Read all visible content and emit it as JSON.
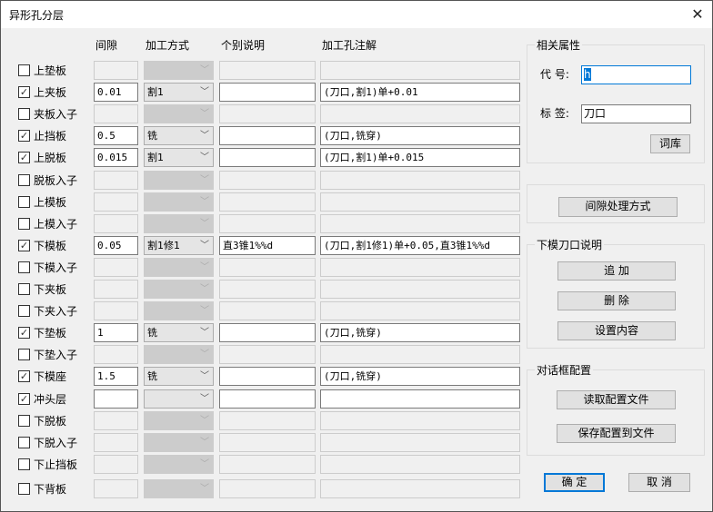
{
  "window": {
    "title": "异形孔分层",
    "close_icon": "close-icon"
  },
  "headers": {
    "gap": "间隙",
    "method": "加工方式",
    "note": "个别说明",
    "annotation": "加工孔注解"
  },
  "rows": [
    {
      "label": "上垫板",
      "checked": false,
      "gap": "",
      "method": "",
      "note": "",
      "annotation": "",
      "enabled": false
    },
    {
      "label": "上夹板",
      "checked": true,
      "gap": "0.01",
      "method": "割1",
      "note": "",
      "annotation": "(刀口,割1)单+0.01",
      "enabled": true
    },
    {
      "label": "夹板入子",
      "checked": false,
      "gap": "",
      "method": "",
      "note": "",
      "annotation": "",
      "enabled": false
    },
    {
      "label": "止挡板",
      "checked": true,
      "gap": "0.5",
      "method": "铣",
      "note": "",
      "annotation": "(刀口,铣穿)",
      "enabled": true
    },
    {
      "label": "上脱板",
      "checked": true,
      "gap": "0.015",
      "method": "割1",
      "note": "",
      "annotation": "(刀口,割1)单+0.015",
      "enabled": true
    },
    {
      "label": "脱板入子",
      "checked": false,
      "gap": "",
      "method": "",
      "note": "",
      "annotation": "",
      "enabled": false
    },
    {
      "label": "上模板",
      "checked": false,
      "gap": "",
      "method": "",
      "note": "",
      "annotation": "",
      "enabled": false
    },
    {
      "label": "上模入子",
      "checked": false,
      "gap": "",
      "method": "",
      "note": "",
      "annotation": "",
      "enabled": false
    },
    {
      "label": "下模板",
      "checked": true,
      "gap": "0.05",
      "method": "割1修1",
      "note": "直3锥1%%d",
      "annotation": "(刀口,割1修1)单+0.05,直3锥1%%d",
      "enabled": true
    },
    {
      "label": "下模入子",
      "checked": false,
      "gap": "",
      "method": "",
      "note": "",
      "annotation": "",
      "enabled": false
    },
    {
      "label": "下夹板",
      "checked": false,
      "gap": "",
      "method": "",
      "note": "",
      "annotation": "",
      "enabled": false
    },
    {
      "label": "下夹入子",
      "checked": false,
      "gap": "",
      "method": "",
      "note": "",
      "annotation": "",
      "enabled": false
    },
    {
      "label": "下垫板",
      "checked": true,
      "gap": "1",
      "method": "铣",
      "note": "",
      "annotation": "(刀口,铣穿)",
      "enabled": true
    },
    {
      "label": "下垫入子",
      "checked": false,
      "gap": "",
      "method": "",
      "note": "",
      "annotation": "",
      "enabled": false
    },
    {
      "label": "下模座",
      "checked": true,
      "gap": "1.5",
      "method": "铣",
      "note": "",
      "annotation": "(刀口,铣穿)",
      "enabled": true
    },
    {
      "label": "冲头层",
      "checked": true,
      "gap": "",
      "method": "",
      "note": "",
      "annotation": "",
      "enabled": true
    },
    {
      "label": "下脱板",
      "checked": false,
      "gap": "",
      "method": "",
      "note": "",
      "annotation": "",
      "enabled": false
    },
    {
      "label": "下脱入子",
      "checked": false,
      "gap": "",
      "method": "",
      "note": "",
      "annotation": "",
      "enabled": false
    },
    {
      "label": "下止挡板",
      "checked": false,
      "gap": "",
      "method": "",
      "note": "",
      "annotation": "",
      "enabled": false
    },
    {
      "label": "下背板",
      "checked": false,
      "gap": "",
      "method": "",
      "note": "",
      "annotation": "",
      "enabled": false
    }
  ],
  "props": {
    "title": "相关属性",
    "code_label": "代 号:",
    "code_value": "h",
    "tag_label": "标 签:",
    "tag_value": "刀口",
    "lexicon": "词库"
  },
  "gap_mode": {
    "button": "间隙处理方式"
  },
  "die_edge": {
    "title": "下模刀口说明",
    "add": "追 加",
    "delete": "删 除",
    "set_content": "设置内容"
  },
  "config": {
    "title": "对话框配置",
    "read": "读取配置文件",
    "save": "保存配置到文件"
  },
  "footer": {
    "ok": "确 定",
    "cancel": "取 消"
  }
}
